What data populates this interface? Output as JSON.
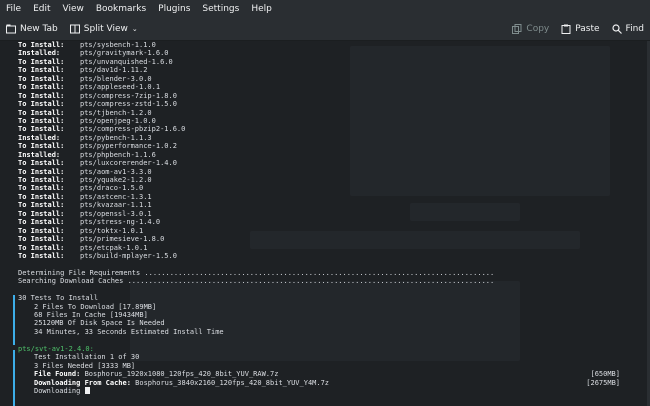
{
  "menu": [
    "File",
    "Edit",
    "View",
    "Bookmarks",
    "Plugins",
    "Settings",
    "Help"
  ],
  "toolbar": {
    "new_tab": "New Tab",
    "split_view": "Split View",
    "copy": "Copy",
    "paste": "Paste",
    "find": "Find"
  },
  "install_list": [
    {
      "status": "To Install:",
      "pkg": "pts/sysbench-1.1.0"
    },
    {
      "status": "Installed:",
      "pkg": "pts/gravitymark-1.6.0"
    },
    {
      "status": "To Install:",
      "pkg": "pts/unvanquished-1.6.0"
    },
    {
      "status": "To Install:",
      "pkg": "pts/dav1d-1.11.2"
    },
    {
      "status": "To Install:",
      "pkg": "pts/blender-3.0.0"
    },
    {
      "status": "To Install:",
      "pkg": "pts/appleseed-1.0.1"
    },
    {
      "status": "To Install:",
      "pkg": "pts/compress-7zip-1.8.0"
    },
    {
      "status": "To Install:",
      "pkg": "pts/compress-zstd-1.5.0"
    },
    {
      "status": "To Install:",
      "pkg": "pts/tjbench-1.2.0"
    },
    {
      "status": "To Install:",
      "pkg": "pts/openjpeg-1.0.0"
    },
    {
      "status": "To Install:",
      "pkg": "pts/compress-pbzip2-1.6.0"
    },
    {
      "status": "Installed:",
      "pkg": "pts/pybench-1.1.3"
    },
    {
      "status": "To Install:",
      "pkg": "pts/pyperformance-1.0.2"
    },
    {
      "status": "Installed:",
      "pkg": "pts/phpbench-1.1.6"
    },
    {
      "status": "To Install:",
      "pkg": "pts/luxcorerender-1.4.0"
    },
    {
      "status": "To Install:",
      "pkg": "pts/aom-av1-3.3.0"
    },
    {
      "status": "To Install:",
      "pkg": "pts/yquake2-1.2.0"
    },
    {
      "status": "To Install:",
      "pkg": "pts/draco-1.5.0"
    },
    {
      "status": "To Install:",
      "pkg": "pts/astcenc-1.3.1"
    },
    {
      "status": "To Install:",
      "pkg": "pts/kvazaar-1.1.1"
    },
    {
      "status": "To Install:",
      "pkg": "pts/openssl-3.0.1"
    },
    {
      "status": "To Install:",
      "pkg": "pts/stress-ng-1.4.0"
    },
    {
      "status": "To Install:",
      "pkg": "pts/toktx-1.0.1"
    },
    {
      "status": "To Install:",
      "pkg": "pts/primesieve-1.8.0"
    },
    {
      "status": "To Install:",
      "pkg": "pts/etcpak-1.0.1"
    },
    {
      "status": "To Install:",
      "pkg": "pts/build-mplayer-1.5.0"
    }
  ],
  "determining": "Determining File Requirements ...................................................................................",
  "searching": "Searching Download Caches .......................................................................................",
  "summary": {
    "title": "30 Tests To Install",
    "l1": "2 Files To Download [17.89MB]",
    "l2": "68 Files In Cache [19434MB]",
    "l3": "25120MB Of Disk Space Is Needed",
    "l4": "34 Minutes, 33 Seconds Estimated Install Time"
  },
  "current": {
    "test": "pts/svt-av1-2.4.0:",
    "l1": "Test Installation 1 of 30",
    "l2": "3 Files Needed [3333 MB]",
    "found_label": "File Found:",
    "found_file": "Bosphorus_1920x1080_120fps_420_8bit_YUV_RAW.7z",
    "found_size": "[650MB]",
    "dl_label": "Downloading From Cache:",
    "dl_file": "Bosphorus_3840x2160_120fps_420_8bit_YUV_Y4M.7z",
    "dl_size": "[2675MB]",
    "downloading": "Downloading"
  }
}
